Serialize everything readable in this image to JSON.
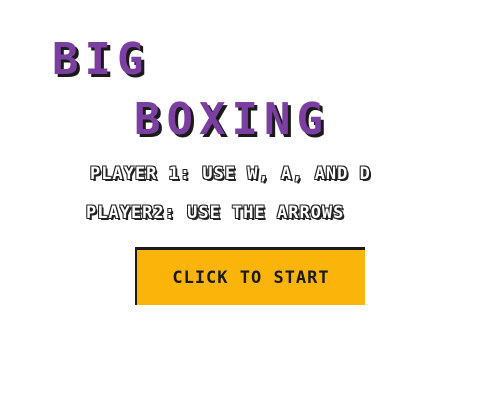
{
  "title": {
    "line1": "BIG",
    "line2": "BOXING"
  },
  "instructions": {
    "player1": "PLAYER 1: USE W, A, AND D",
    "player2": "PLAYER2: USE THE ARROWS"
  },
  "start_button": {
    "label": "CLICK TO START"
  },
  "colors": {
    "title": "#7a3fa0",
    "title_shadow": "#1a1a1a",
    "button_bg": "#fbb40a",
    "button_text": "#1a1a1a",
    "background": "#ffffff"
  }
}
